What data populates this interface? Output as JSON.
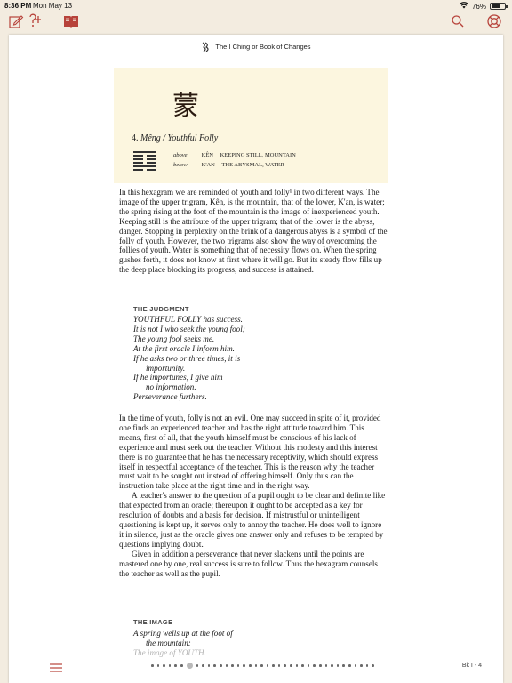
{
  "status_bar": {
    "time": "8:36 PM",
    "date": "Mon May 13",
    "battery": "76%"
  },
  "toolbar": {
    "icons": [
      "edit-note-icon",
      "help-lookup-icon",
      "book-icon",
      "search-icon",
      "lifebuoy-icon"
    ],
    "accent_color": "#b7423a"
  },
  "page": {
    "running_head": "The I Ching or Book of Changes",
    "hexagram": {
      "character": "蒙",
      "number": "4.",
      "name": "Mêng / Youthful Folly",
      "above_label": "above",
      "above_name": "KÊN",
      "above_desc": "KEEPING STILL, MOUNTAIN",
      "below_label": "below",
      "below_name": "K'AN",
      "below_desc": "THE ABYSMAL, WATER"
    },
    "intro_paragraph": "In this hexagram we are reminded of youth and folly¹ in two different ways. The image of the upper trigram, Kên, is the mountain, that of the lower, K'an, is water; the spring rising at the foot of the mountain is the image of inexperienced youth. Keeping still is the attribute of the upper trigram; that of the lower is the abyss, danger. Stopping in perplexity on the brink of a dangerous abyss is a symbol of the folly of youth. However, the two trigrams also show the way of overcoming the follies of youth. Water is something that of necessity flows on. When the spring gushes forth, it does not know at first where it will go. But its steady flow fills up the deep place blocking its progress, and success is attained.",
    "judgment_heading": "THE JUDGMENT",
    "judgment_lines": [
      {
        "text": "YOUTHFUL FOLLY has success.",
        "sub": false
      },
      {
        "text": "It is not I who seek the young fool;",
        "sub": false
      },
      {
        "text": "The young fool seeks me.",
        "sub": false
      },
      {
        "text": "At the first oracle I inform him.",
        "sub": false
      },
      {
        "text": "If he asks two or three times, it is",
        "sub": false
      },
      {
        "text": "importunity.",
        "sub": true
      },
      {
        "text": "If he importunes, I give him",
        "sub": false
      },
      {
        "text": "no information.",
        "sub": true
      },
      {
        "text": "Perseverance furthers.",
        "sub": false
      }
    ],
    "judgment_commentary": [
      "In the time of youth, folly is not an evil. One may succeed in spite of it, provided one finds an experienced teacher and has the right attitude toward him. This means, first of all, that the youth himself must be conscious of his lack of experience and must seek out the teacher. Without this modesty and this interest there is no guarantee that he has the necessary receptivity, which should express itself in respectful acceptance of the teacher. This is the reason why the teacher must wait to be sought out instead of offering himself. Only thus can the instruction take place at the right time and in the right way.",
      "A teacher's answer to the question of a pupil ought to be clear and definite like that expected from an oracle; thereupon it ought to be accepted as a key for resolution of doubts and a basis for decision. If mistrustful or unintelligent questioning is kept up, it serves only to annoy the teacher. He does well to ignore it in silence, just as the oracle gives one answer only and refuses to be tempted by questions implying doubt.",
      "Given in addition a perseverance that never slackens until the points are mastered one by one, real success is sure to follow. Thus the hexagram counsels the teacher as well as the pupil."
    ],
    "image_heading": "THE IMAGE",
    "image_lines": [
      {
        "text": "A spring wells up at the foot of",
        "sub": false
      },
      {
        "text": "the mountain:",
        "sub": true
      },
      {
        "text": "The image of YOUTH.",
        "sub": false
      }
    ]
  },
  "bottom_bar": {
    "page_label": "Bk I - 4",
    "dot_count": 38,
    "active_dot": 6
  }
}
